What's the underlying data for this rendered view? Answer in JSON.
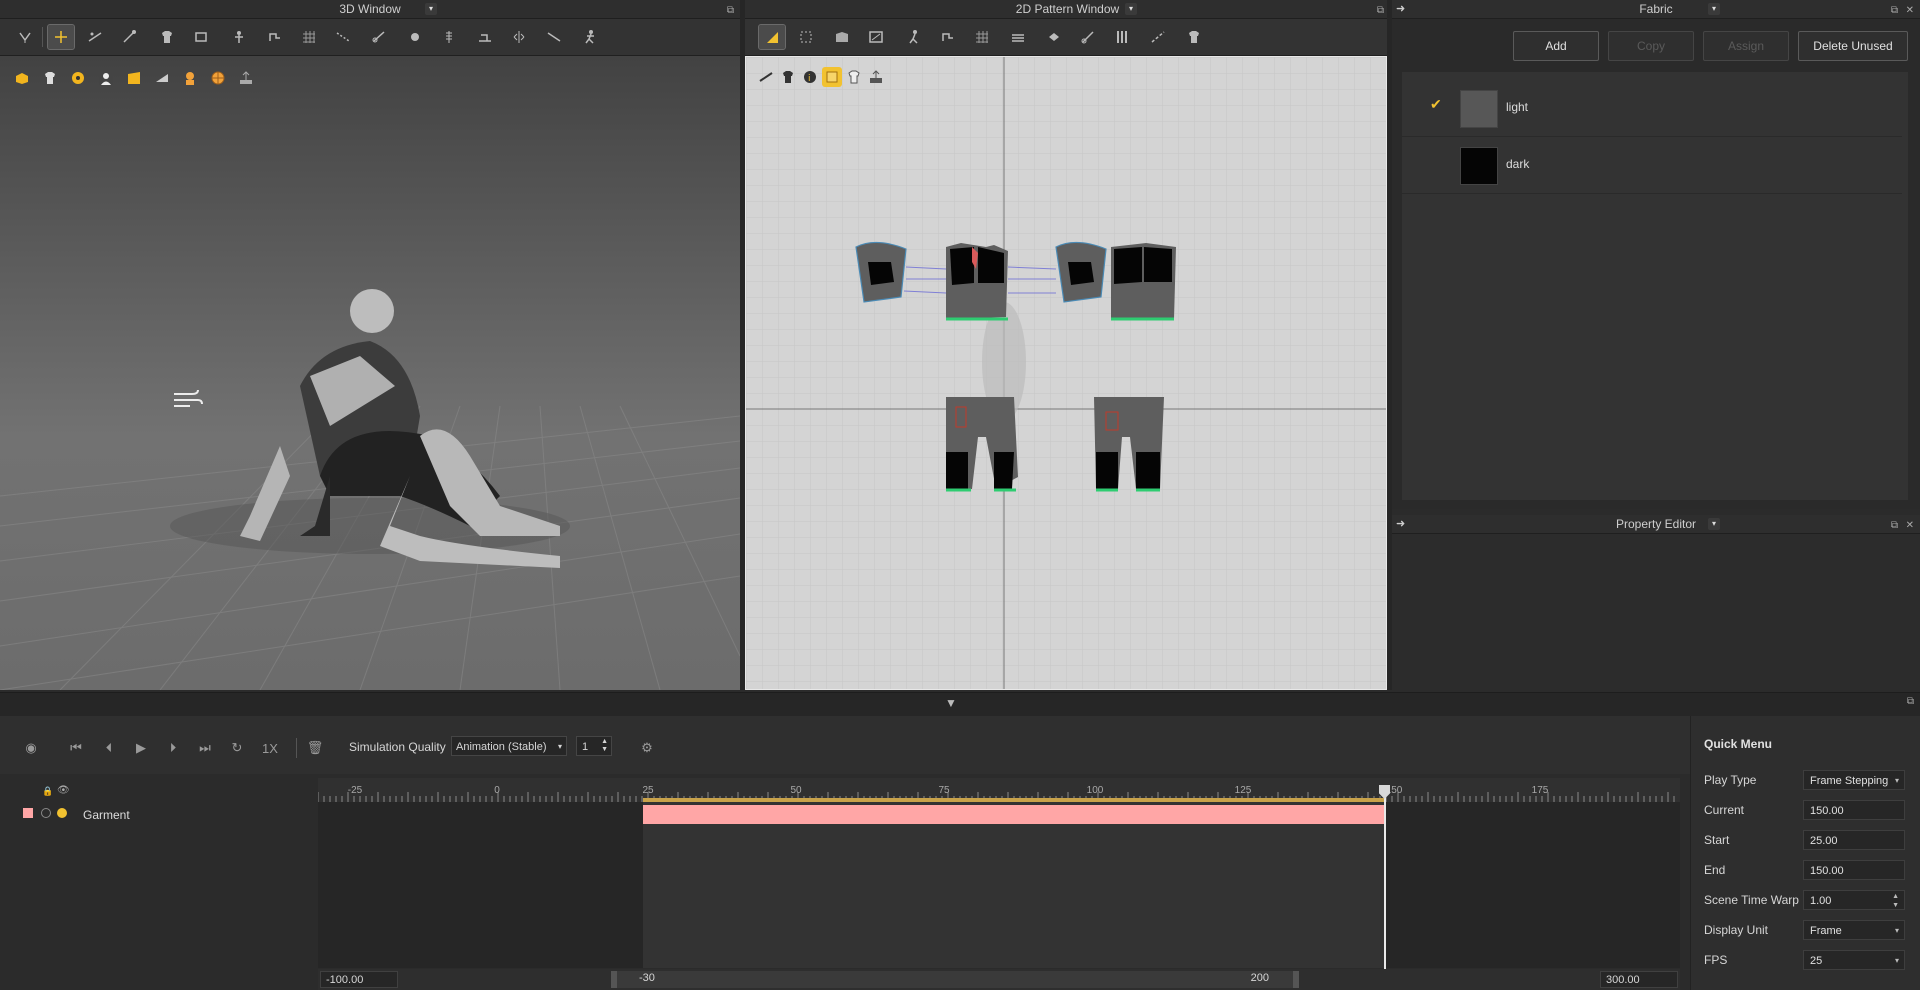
{
  "windows": {
    "view3d": {
      "title": "3D Window"
    },
    "pattern2d": {
      "title": "2D Pattern Window"
    },
    "fabric": {
      "title": "Fabric"
    },
    "property_editor": {
      "title": "Property Editor"
    }
  },
  "fabric": {
    "buttons": {
      "add": "Add",
      "copy": "Copy",
      "assign": "Assign",
      "delete_unused": "Delete Unused"
    },
    "items": [
      {
        "name": "light",
        "color": "#575757",
        "checked": true
      },
      {
        "name": "dark",
        "color": "#050505",
        "checked": false
      }
    ]
  },
  "playback": {
    "speed": "1X",
    "sim_quality_label": "Simulation Quality",
    "sim_quality_value": "Animation (Stable)",
    "sim_steps": "1"
  },
  "timeline": {
    "track_name": "Garment",
    "ticks": [
      "-25",
      "0",
      "25",
      "50",
      "75",
      "100",
      "125",
      "150",
      "175"
    ],
    "range_start_field": "-100.00",
    "range_end_field": "300.00",
    "scroll_left": "-30",
    "scroll_right": "200",
    "clip_start_frame": 25,
    "clip_end_frame": 150,
    "playhead_frame": 150
  },
  "quick_menu": {
    "title": "Quick Menu",
    "rows": [
      {
        "label": "Play Type",
        "value": "Frame Stepping",
        "dropdown": true
      },
      {
        "label": "Current",
        "value": "150.00"
      },
      {
        "label": "Start",
        "value": "25.00"
      },
      {
        "label": "End",
        "value": "150.00"
      },
      {
        "label": "Scene Time Warp",
        "value": "1.00",
        "spinner": true
      },
      {
        "label": "Display Unit",
        "value": "Frame",
        "dropdown": true
      },
      {
        "label": "FPS",
        "value": "25",
        "dropdown": true
      }
    ]
  },
  "colors": {
    "accent_yellow": "#f2c230",
    "clip_pink": "#ffa6a6",
    "panel_bg": "#2b2b2b",
    "pattern_bg": "#d4d4d4"
  }
}
